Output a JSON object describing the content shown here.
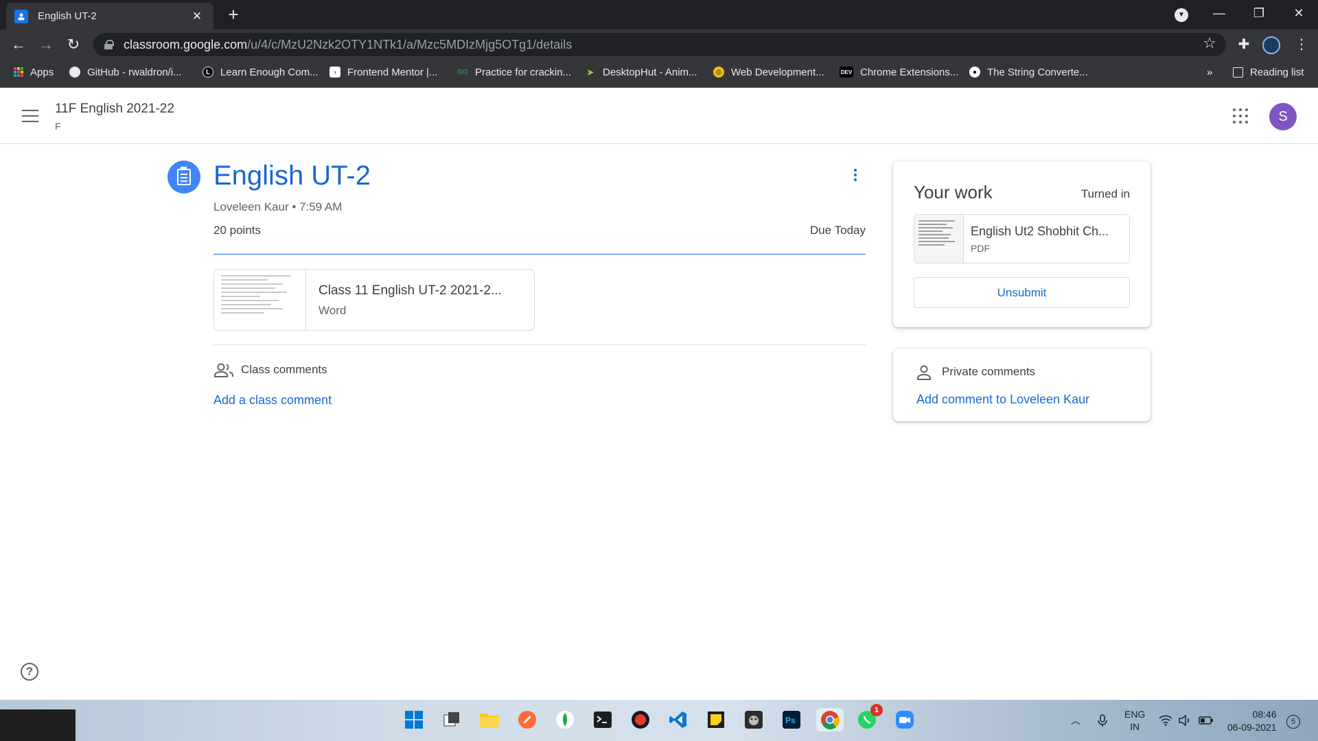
{
  "browser": {
    "tab_title": "English UT-2",
    "url_host": "classroom.google.com",
    "url_path": "/u/4/c/MzU2Nzk2OTY1NTk1/a/Mzc5MDIzMjg5OTg1/details",
    "bookmarks": [
      {
        "label": "Apps",
        "icon": "apps-grid-icon",
        "color": "#ea4335"
      },
      {
        "label": "GitHub - rwaldron/i...",
        "icon": "github-icon",
        "color": "#e8eaed"
      },
      {
        "label": "Learn Enough Com...",
        "icon": "learn-enough-icon",
        "color": "#000000"
      },
      {
        "label": "Frontend Mentor |...",
        "icon": "frontend-mentor-icon",
        "color": "#ffffff"
      },
      {
        "label": "Practice for crackin...",
        "icon": "gfg-icon",
        "color": "#2f8d46"
      },
      {
        "label": "DesktopHut - Anim...",
        "icon": "desktophut-icon",
        "color": "#9acd32"
      },
      {
        "label": "Web Development...",
        "icon": "web-dev-icon",
        "color": "#f4c20d"
      },
      {
        "label": "Chrome Extensions...",
        "icon": "dev-icon",
        "color": "#000000"
      },
      {
        "label": "The String Converte...",
        "icon": "string-converter-icon",
        "color": "#ffffff"
      }
    ],
    "overflow_label": "»",
    "reading_list": "Reading list"
  },
  "header": {
    "class_title": "11F English 2021-22",
    "class_section": "F",
    "account_initial": "S"
  },
  "assignment": {
    "title": "English UT-2",
    "meta": "Loveleen Kaur • 7:59 AM",
    "points": "20 points",
    "due": "Due Today",
    "attachment": {
      "name": "Class 11 English UT-2 2021-2...",
      "type": "Word"
    },
    "class_comments_label": "Class comments",
    "add_class_comment": "Add a class comment"
  },
  "your_work": {
    "title": "Your work",
    "status": "Turned in",
    "file": {
      "name": "English Ut2 Shobhit Ch...",
      "type": "PDF"
    },
    "unsubmit_label": "Unsubmit"
  },
  "private_comments": {
    "label": "Private comments",
    "add_label": "Add comment to Loveleen Kaur"
  },
  "taskbar": {
    "lang_line1": "ENG",
    "lang_line2": "IN",
    "time": "08:46",
    "date": "06-09-2021",
    "notification_count": "5",
    "whatsapp_badge": "1"
  },
  "colors": {
    "accent_blue": "#1967d2",
    "icon_blue": "#4285f4",
    "avatar_purple": "#7e57c2"
  }
}
